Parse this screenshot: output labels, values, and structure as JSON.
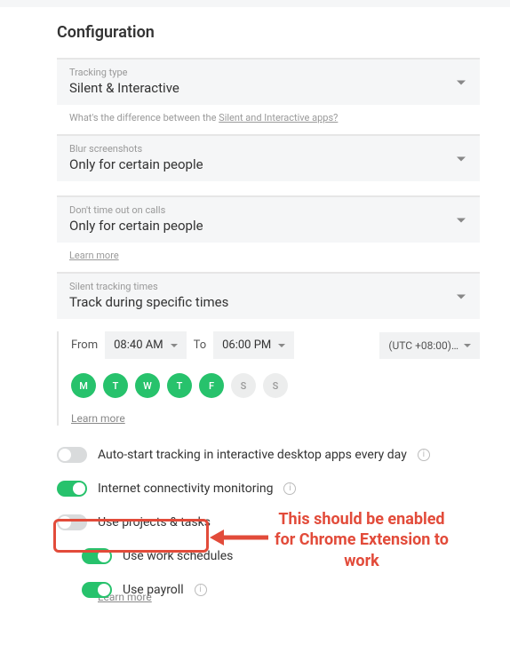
{
  "title": "Configuration",
  "fields": {
    "tracking_type": {
      "label": "Tracking type",
      "value": "Silent & Interactive"
    },
    "tracking_helper_prefix": "What's the difference between the ",
    "tracking_helper_link": "Silent and Interactive apps?",
    "blur": {
      "label": "Blur screenshots",
      "value": "Only for certain people"
    },
    "calls": {
      "label": "Don't time out on calls",
      "value": "Only for certain people"
    },
    "calls_learn_more": "Learn more",
    "silent_times": {
      "label": "Silent tracking times",
      "value": "Track during specific times"
    }
  },
  "time": {
    "from_label": "From",
    "from_value": "08:40 AM",
    "to_label": "To",
    "to_value": "06:00 PM",
    "tz": "(UTC +08:00)…",
    "days": [
      {
        "letter": "M",
        "on": true
      },
      {
        "letter": "T",
        "on": true
      },
      {
        "letter": "W",
        "on": true
      },
      {
        "letter": "T",
        "on": true
      },
      {
        "letter": "F",
        "on": true
      },
      {
        "letter": "S",
        "on": false
      },
      {
        "letter": "S",
        "on": false
      }
    ],
    "learn_more": "Learn more"
  },
  "toggles": {
    "autostart": {
      "label": "Auto-start tracking in interactive desktop apps every day",
      "on": false,
      "info": true
    },
    "internet": {
      "label": "Internet connectivity monitoring",
      "on": true,
      "info": true
    },
    "projects": {
      "label": "Use projects & tasks",
      "on": false,
      "info": false
    },
    "schedules": {
      "label": "Use work schedules",
      "on": true,
      "info": false
    },
    "payroll": {
      "label": "Use payroll",
      "on": true,
      "info": true,
      "learn_more": "Learn more"
    }
  },
  "annotation": {
    "text": "This should be enabled for Chrome Extension to work"
  }
}
